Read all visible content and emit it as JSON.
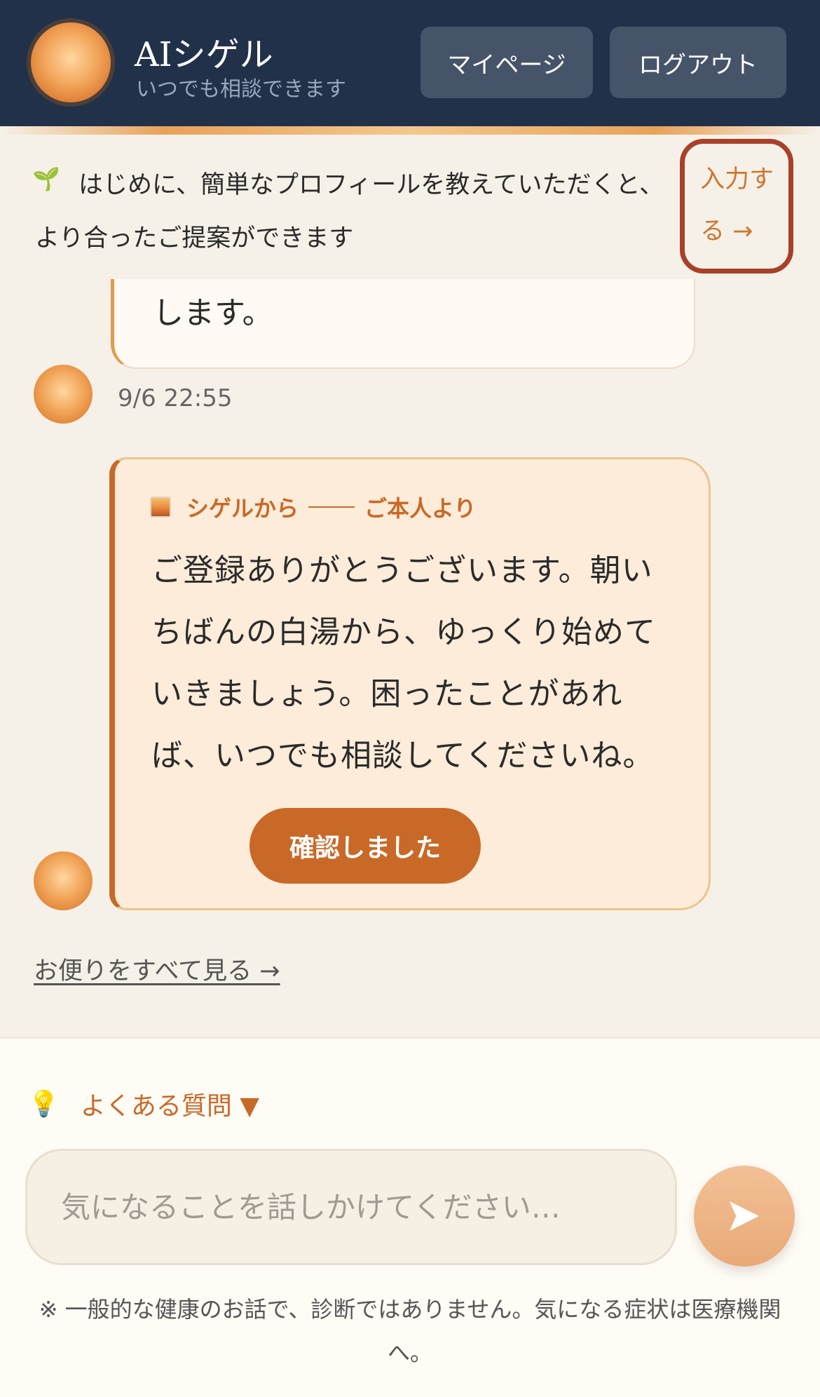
{
  "header": {
    "title": "AIシゲル",
    "subtitle": "いつでも相談できます",
    "mypage_label": "マイページ",
    "logout_label": "ログアウト",
    "bg_color": "#21314a"
  },
  "profile_banner": {
    "icon": "sprout-icon",
    "text": "はじめに、簡単なプロフィールを教えていただくと、より合ったご提案ができます",
    "link_label": "入力する →"
  },
  "messages": {
    "previous": {
      "tail_text": "します。",
      "timestamp": "9/6 22:55"
    },
    "letter": {
      "sender": "シゲルから",
      "from_label": "ご本人より",
      "body": "ご登録ありがとうございます。朝いちばんの白湯から、ゆっくり始めていきましょう。困ったことがあれば、いつでも相談してくださいね。",
      "confirm_label": "確認しました",
      "accent_color": "#c96928"
    },
    "all_letters_link": "お便りをすべて見る →"
  },
  "composer": {
    "faq_label": "よくある質問 ▼",
    "input_placeholder": "気になることを話しかけてください…",
    "input_value": "",
    "send_icon": "send-icon"
  },
  "disclaimer": "※ 一般的な健康のお話で、診断ではありません。気になる症状は医療機関へ。"
}
